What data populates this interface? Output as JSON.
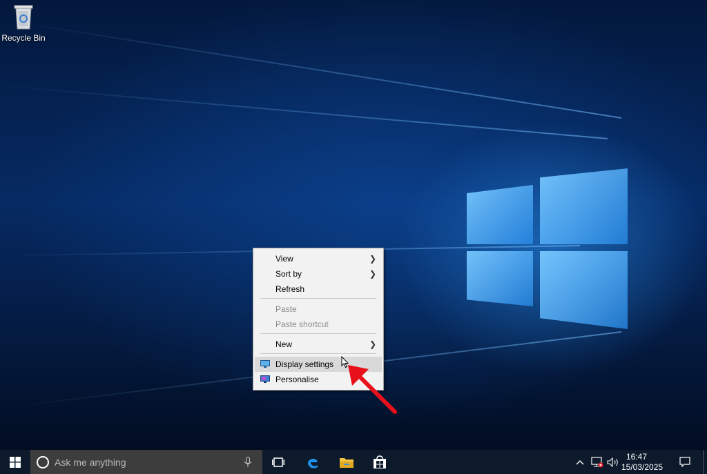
{
  "desktop": {
    "icons": [
      {
        "label": "Recycle Bin",
        "icon": "recycle-bin-icon"
      }
    ]
  },
  "context_menu": {
    "items": [
      {
        "label": "View",
        "has_submenu": true
      },
      {
        "label": "Sort by",
        "has_submenu": true
      },
      {
        "label": "Refresh"
      },
      {
        "label": "Paste",
        "disabled": true
      },
      {
        "label": "Paste shortcut",
        "disabled": true
      },
      {
        "label": "New",
        "has_submenu": true
      },
      {
        "label": "Display settings",
        "icon": "display-icon",
        "highlighted": true
      },
      {
        "label": "Personalise",
        "icon": "personalise-icon"
      }
    ]
  },
  "taskbar": {
    "search_placeholder": "Ask me anything",
    "pinned": [
      "task-view-icon",
      "edge-icon",
      "file-explorer-icon",
      "store-icon"
    ],
    "tray": [
      "chevron-up-icon",
      "network-disconnected-icon",
      "volume-icon",
      "action-center-icon"
    ],
    "clock": {
      "time": "16:47",
      "date": "15/03/2025"
    }
  },
  "colors": {
    "accent_arrow": "#e8101a",
    "menu_bg": "#f2f2f2",
    "taskbar_bg": "#0d1a2b",
    "search_bg": "#3d3d3d"
  }
}
